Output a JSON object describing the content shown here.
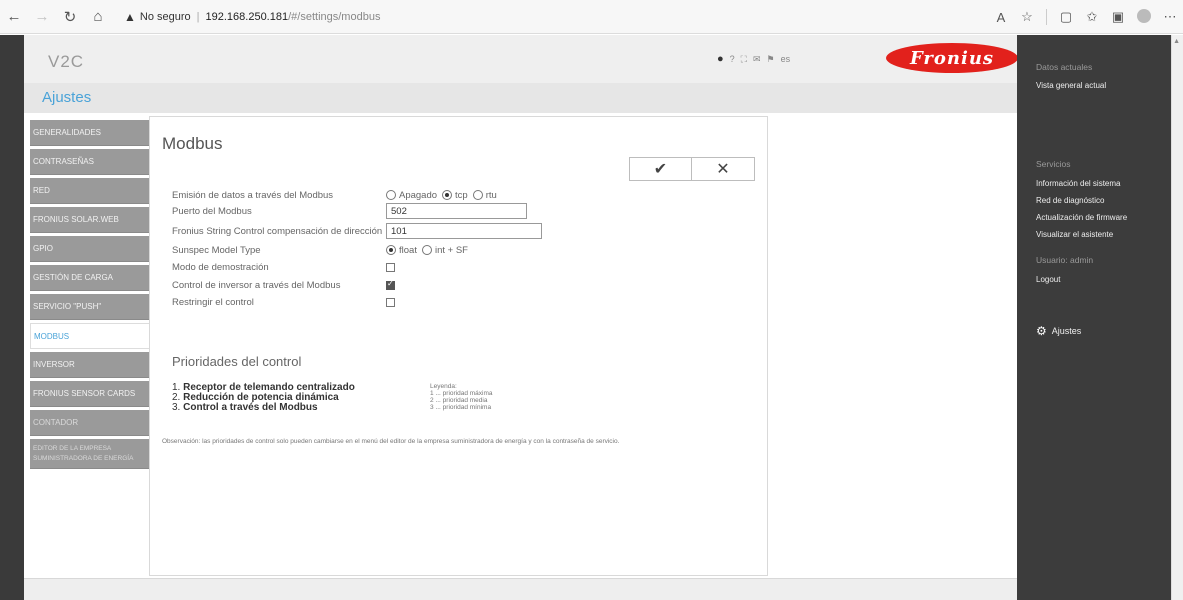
{
  "browser": {
    "security_label": "No seguro",
    "url_host": "192.168.250.181",
    "url_path": "/#/settings/modbus"
  },
  "header": {
    "brand": "V2C",
    "language": "es",
    "logo_text": "Fronius",
    "page_title": "Ajustes"
  },
  "side_nav": {
    "items": [
      {
        "label": "GENERALIDADES"
      },
      {
        "label": "CONTRASEÑAS"
      },
      {
        "label": "RED"
      },
      {
        "label": "FRONIUS SOLAR.WEB"
      },
      {
        "label": "GPIO"
      },
      {
        "label": "GESTIÓN DE CARGA"
      },
      {
        "label": "SERVICIO \"PUSH\""
      },
      {
        "label": "MODBUS"
      },
      {
        "label": "INVERSOR"
      },
      {
        "label": "FRONIUS SENSOR CARDS"
      },
      {
        "label": "CONTADOR"
      },
      {
        "label": "EDITOR DE LA EMPRESA SUMINISTRADORA DE ENERGÍA"
      }
    ]
  },
  "panel": {
    "title": "Modbus",
    "confirm_icon": "checkmark-icon",
    "cancel_icon": "close-icon",
    "fields": {
      "data_output": {
        "label": "Emisión de datos a través del Modbus",
        "options": [
          "Apagado",
          "tcp",
          "rtu"
        ],
        "selected": "tcp"
      },
      "port": {
        "label": "Puerto del Modbus",
        "value": "502"
      },
      "string_control": {
        "label": "Fronius String Control compensación de dirección",
        "value": "101"
      },
      "sunspec": {
        "label": "Sunspec Model Type",
        "options": [
          "float",
          "int + SF"
        ],
        "selected": "float"
      },
      "demo_mode": {
        "label": "Modo de demostración",
        "checked": false
      },
      "inverter_control": {
        "label": "Control de inversor a través del Modbus",
        "checked": true
      },
      "restrict_control": {
        "label": "Restringir el control",
        "checked": false
      }
    },
    "priorities": {
      "title": "Prioridades del control",
      "items": [
        {
          "num": "1.",
          "text": "Receptor de telemando centralizado"
        },
        {
          "num": "2.",
          "text": "Reducción de potencia dinámica"
        },
        {
          "num": "3.",
          "text": "Control a través del Modbus"
        }
      ],
      "legend_title": "Leyenda:",
      "legend": [
        {
          "num": "1",
          "text": "... prioridad máxima"
        },
        {
          "num": "2",
          "text": "... prioridad media"
        },
        {
          "num": "3",
          "text": "... prioridad mínima"
        }
      ]
    },
    "note": "Observación: las prioridades de control solo pueden cambiarse en el menú del editor de la empresa suministradora de energía y con la contraseña de servicio."
  },
  "right_sidebar": {
    "current_data_head": "Datos actuales",
    "current_overview": "Vista general actual",
    "services_head": "Servicios",
    "system_info": "Información del sistema",
    "network_diag": "Red de diagnóstico",
    "firmware_update": "Actualización de firmware",
    "wizard": "Visualizar el asistente",
    "user_head": "Usuario: admin",
    "logout": "Logout",
    "settings": "Ajustes"
  }
}
